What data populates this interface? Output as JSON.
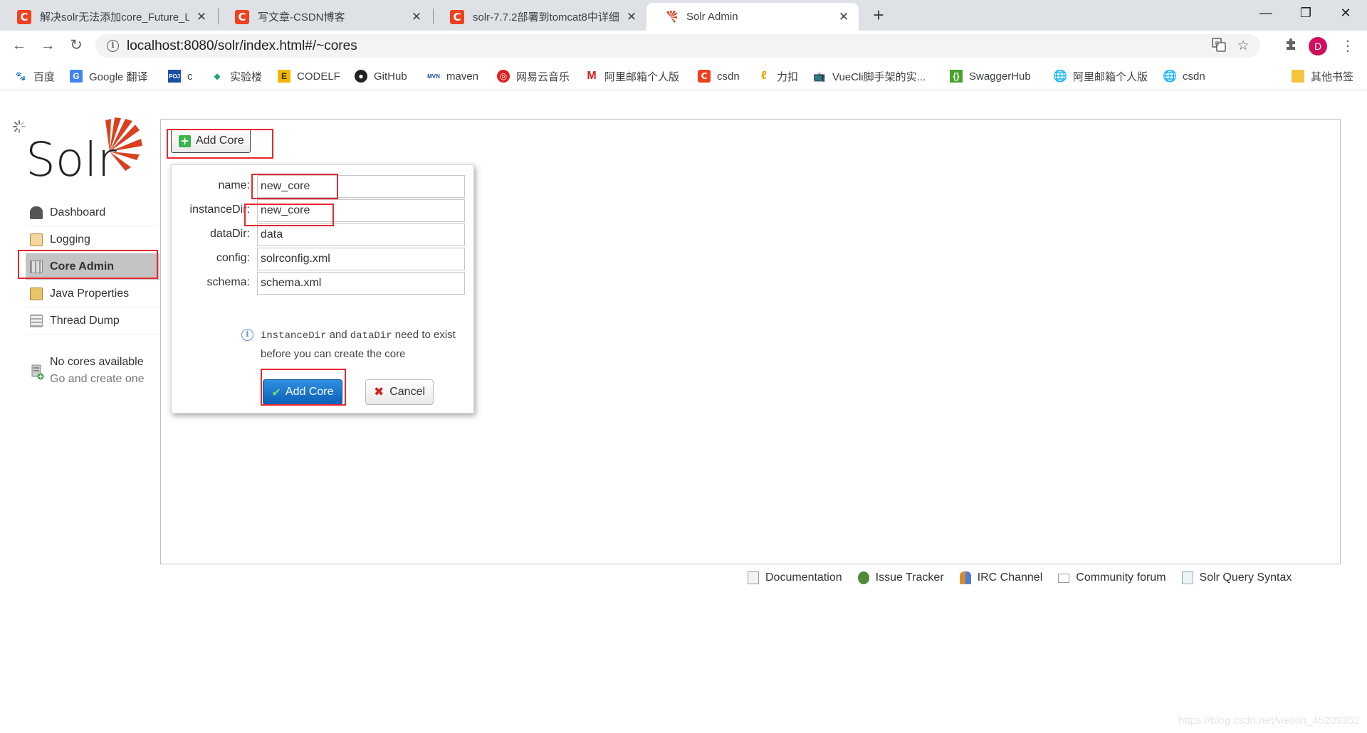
{
  "browser": {
    "tabs": [
      {
        "title": "解决solr无法添加core_Future_LI",
        "favicon": "csdn-icon"
      },
      {
        "title": "写文章-CSDN博客",
        "favicon": "csdn-icon"
      },
      {
        "title": "solr-7.7.2部署到tomcat8中详细",
        "favicon": "csdn-icon"
      },
      {
        "title": "Solr Admin",
        "favicon": "solr-icon"
      }
    ],
    "url": "localhost:8080/solr/index.html#/~cores",
    "profile_initial": "D",
    "bookmarks": [
      {
        "label": "百度"
      },
      {
        "label": "Google 翻译"
      },
      {
        "label": "c"
      },
      {
        "label": "实验楼"
      },
      {
        "label": "CODELF"
      },
      {
        "label": "GitHub"
      },
      {
        "label": "maven"
      },
      {
        "label": "网易云音乐"
      },
      {
        "label": "阿里邮箱个人版"
      },
      {
        "label": "csdn"
      },
      {
        "label": "力扣"
      },
      {
        "label": "VueCli脚手架的实..."
      },
      {
        "label": "SwaggerHub"
      },
      {
        "label": "阿里邮箱个人版"
      },
      {
        "label": "csdn"
      }
    ],
    "other_bookmarks": "其他书签"
  },
  "sidebar": {
    "items": [
      {
        "label": "Dashboard",
        "icon": "dashboard-icon"
      },
      {
        "label": "Logging",
        "icon": "logging-icon"
      },
      {
        "label": "Core Admin",
        "icon": "core-admin-icon",
        "active": true
      },
      {
        "label": "Java Properties",
        "icon": "java-properties-icon"
      },
      {
        "label": "Thread Dump",
        "icon": "thread-dump-icon"
      }
    ],
    "no_cores": {
      "title": "No cores available",
      "subtitle": "Go and create one"
    }
  },
  "core_admin": {
    "add_core_label": "Add Core",
    "dialog": {
      "fields": [
        {
          "label": "name:",
          "value": "new_core"
        },
        {
          "label": "instanceDir:",
          "value": "new_core"
        },
        {
          "label": "dataDir:",
          "value": "data"
        },
        {
          "label": "config:",
          "value": "solrconfig.xml"
        },
        {
          "label": "schema:",
          "value": "schema.xml"
        }
      ],
      "hint": {
        "code1": "instanceDir",
        "and": " and ",
        "code2": "dataDir",
        "rest": " need to exist before you can create the core"
      },
      "submit_label": "Add Core",
      "cancel_label": "Cancel"
    }
  },
  "footer": {
    "links": [
      {
        "label": "Documentation",
        "icon": "documentation-icon"
      },
      {
        "label": "Issue Tracker",
        "icon": "bug-icon"
      },
      {
        "label": "IRC Channel",
        "icon": "irc-icon"
      },
      {
        "label": "Community forum",
        "icon": "mail-icon"
      },
      {
        "label": "Solr Query Syntax",
        "icon": "query-syntax-icon"
      }
    ]
  },
  "watermark": "https://blog.csdn.net/weixin_45209352",
  "colors": {
    "accent_red": "#e8282e",
    "primary_button": "#0b5fb8",
    "solr_brand": "#d9411e"
  }
}
